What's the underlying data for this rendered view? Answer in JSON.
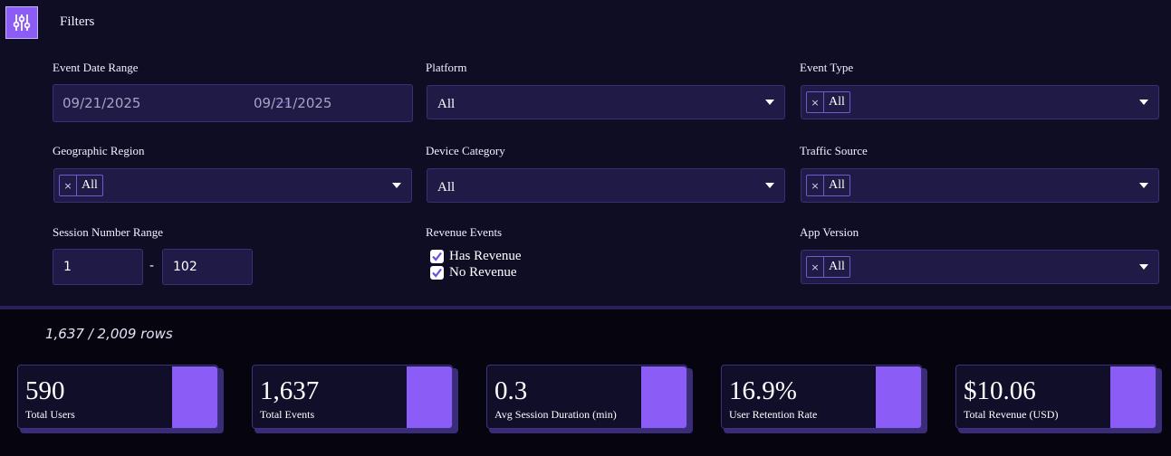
{
  "filters": {
    "title": "Filters",
    "toggle_icon": "sliders-icon",
    "event_date_range": {
      "label": "Event Date Range",
      "start": "09/21/2025",
      "end": "09/21/2025",
      "arrow_icon": "arrow-right-icon"
    },
    "platform": {
      "label": "Platform",
      "value": "All"
    },
    "event_type": {
      "label": "Event Type",
      "tags": [
        "All"
      ]
    },
    "geographic_region": {
      "label": "Geographic Region",
      "tags": [
        "All"
      ]
    },
    "device_category": {
      "label": "Device Category",
      "value": "All"
    },
    "traffic_source": {
      "label": "Traffic Source",
      "tags": [
        "All"
      ]
    },
    "session_number_range": {
      "label": "Session Number Range",
      "min": "1",
      "separator": "-",
      "max": "102"
    },
    "revenue_events": {
      "label": "Revenue Events",
      "options": [
        {
          "label": "Has Revenue",
          "checked": true
        },
        {
          "label": "No Revenue",
          "checked": true
        }
      ]
    },
    "app_version": {
      "label": "App Version",
      "tags": [
        "All"
      ]
    },
    "tag_remove_glyph": "×"
  },
  "summary": {
    "rows_text": "1,637 / 2,009 rows"
  },
  "kpis": [
    {
      "value": "590",
      "label": "Total Users"
    },
    {
      "value": "1,637",
      "label": "Total Events"
    },
    {
      "value": "0.3",
      "label": "Avg Session Duration (min)"
    },
    {
      "value": "16.9%",
      "label": "User Retention Rate"
    },
    {
      "value": "$10.06",
      "label": "Total Revenue (USD)"
    }
  ],
  "colors": {
    "accent": "#8b5cf6",
    "panel_bg": "#0f0d24",
    "page_bg": "#05040f",
    "input_bg": "#1f1a46"
  }
}
